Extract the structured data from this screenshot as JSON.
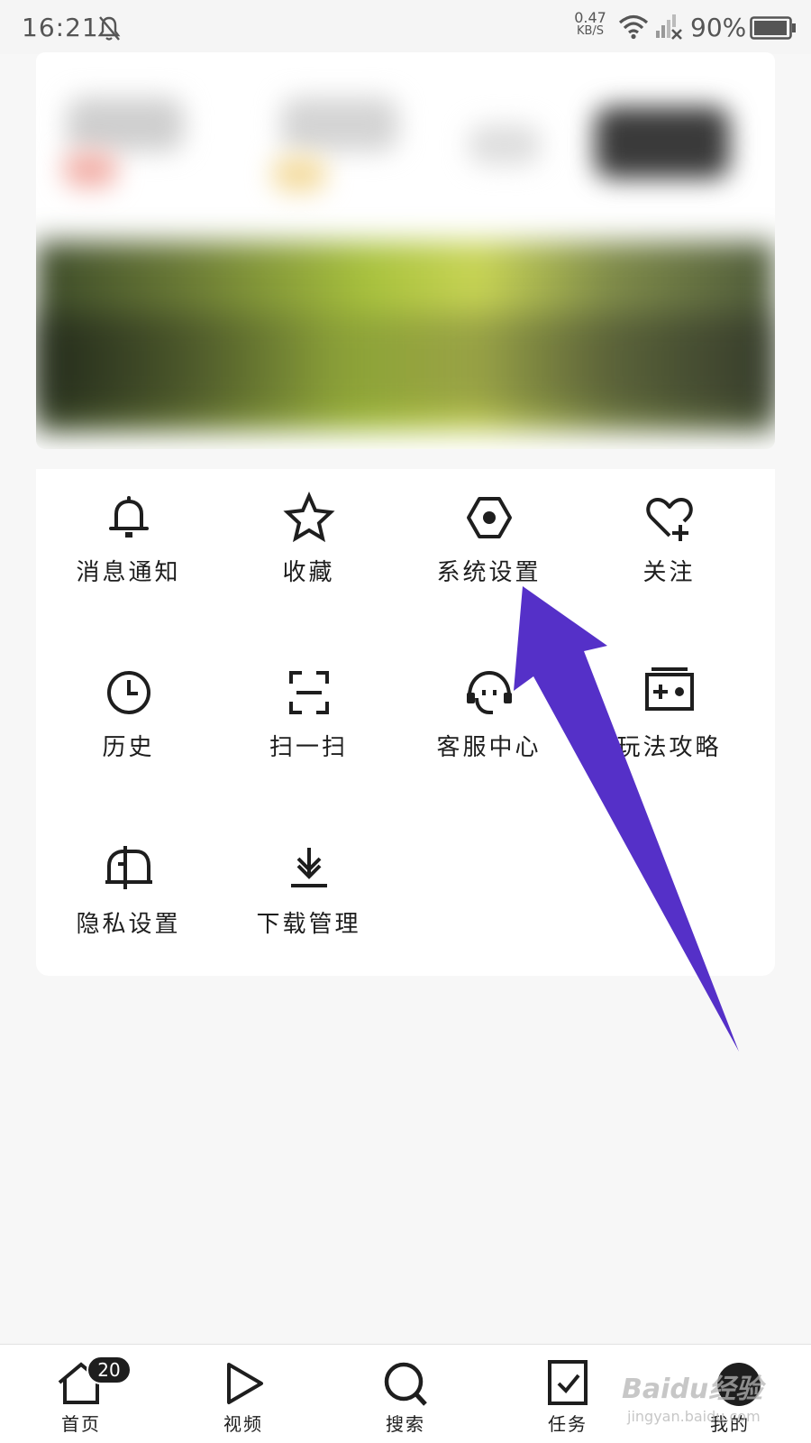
{
  "status_bar": {
    "time": "16:21",
    "net_speed_value": "0.47",
    "net_speed_unit": "KB/S",
    "battery_pct": "90%",
    "icons": [
      "bell-muted-icon",
      "wifi-icon",
      "signal-off-icon",
      "battery-icon"
    ]
  },
  "menu": {
    "items": [
      {
        "label": "消息通知",
        "icon": "bell-icon"
      },
      {
        "label": "收藏",
        "icon": "star-icon"
      },
      {
        "label": "系统设置",
        "icon": "hexagon-settings-icon"
      },
      {
        "label": "关注",
        "icon": "heart-plus-icon"
      },
      {
        "label": "历史",
        "icon": "clock-icon"
      },
      {
        "label": "扫一扫",
        "icon": "scan-icon"
      },
      {
        "label": "客服中心",
        "icon": "headset-icon"
      },
      {
        "label": "玩法攻略",
        "icon": "game-guide-icon"
      },
      {
        "label": "隐私设置",
        "icon": "mailbox-icon"
      },
      {
        "label": "下载管理",
        "icon": "download-icon"
      }
    ]
  },
  "bottom_nav": {
    "items": [
      {
        "label": "首页",
        "icon": "home-icon",
        "badge": "20"
      },
      {
        "label": "视频",
        "icon": "play-icon"
      },
      {
        "label": "搜索",
        "icon": "search-icon"
      },
      {
        "label": "任务",
        "icon": "task-check-icon"
      },
      {
        "label": "我的",
        "icon": "avatar"
      }
    ]
  },
  "watermark": {
    "line1": "Baidu经验",
    "line2": "jingyan.baidu.com"
  },
  "colors": {
    "accent_arrow": "#5530c8",
    "icon": "#1e1e1e",
    "background": "#f7f7f7"
  }
}
